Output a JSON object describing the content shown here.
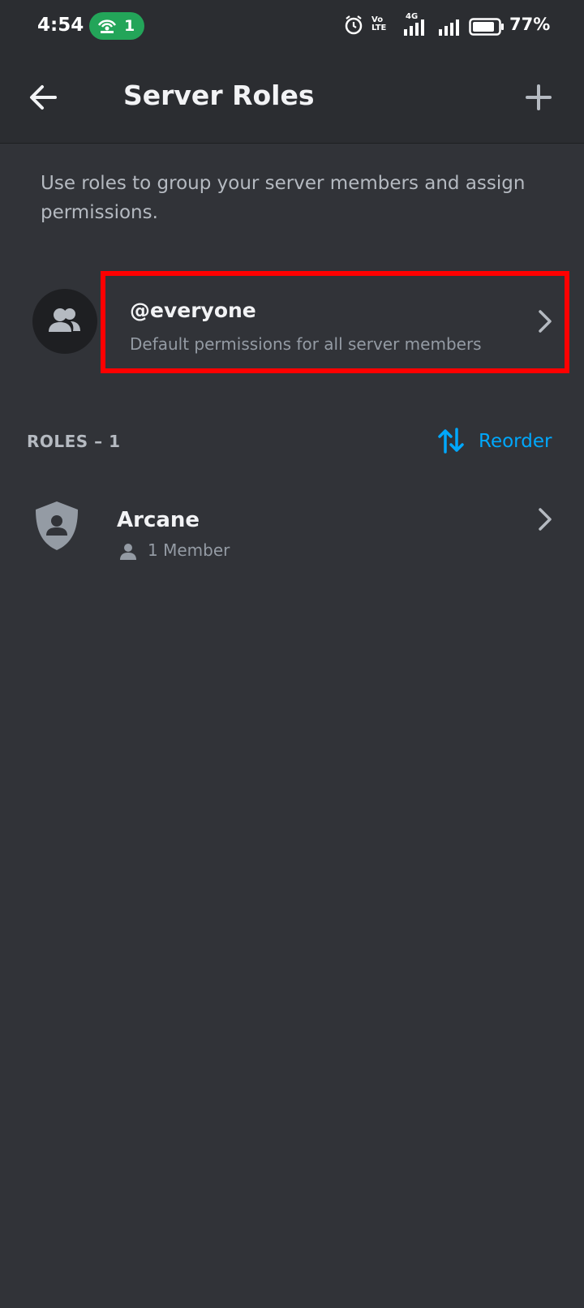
{
  "status_bar": {
    "time": "4:54",
    "hotspot_count": "1",
    "network_volte": "Vo LTE",
    "network_type": "4G",
    "battery": "77%",
    "icons": [
      "hotspot-icon",
      "alarm-icon",
      "volte-icon",
      "signal-4g-icon",
      "signal-icon",
      "battery-icon"
    ]
  },
  "header": {
    "title": "Server Roles",
    "back_icon": "arrow-left-icon",
    "add_icon": "plus-icon"
  },
  "description": "Use roles to group your server members and assign permissions.",
  "everyone": {
    "name": "@everyone",
    "subtitle": "Default permissions for all server members",
    "icon": "members-group-icon"
  },
  "roles_section": {
    "header": "ROLES – 1",
    "reorder_label": "Reorder",
    "reorder_icon": "reorder-arrows-icon",
    "roles": [
      {
        "name": "Arcane",
        "members": "1 Member",
        "icon": "shield-user-icon"
      }
    ]
  },
  "colors": {
    "background": "#313338",
    "header_bg": "#2b2d31",
    "accent": "#00a8fc",
    "highlight": "#ff0000",
    "hotspot": "#23a559"
  }
}
